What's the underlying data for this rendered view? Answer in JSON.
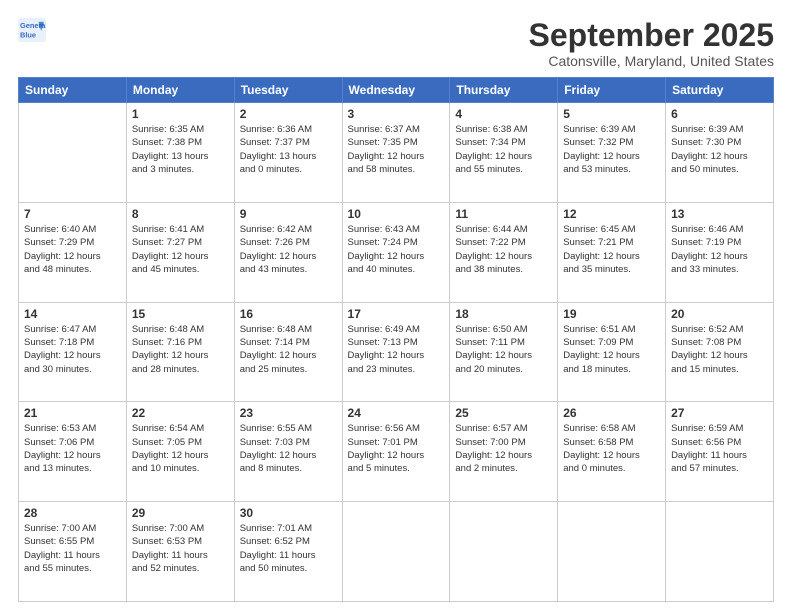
{
  "header": {
    "logo_line1": "General",
    "logo_line2": "Blue",
    "month_title": "September 2025",
    "location": "Catonsville, Maryland, United States"
  },
  "weekdays": [
    "Sunday",
    "Monday",
    "Tuesday",
    "Wednesday",
    "Thursday",
    "Friday",
    "Saturday"
  ],
  "weeks": [
    [
      {
        "day": "",
        "info": ""
      },
      {
        "day": "1",
        "info": "Sunrise: 6:35 AM\nSunset: 7:38 PM\nDaylight: 13 hours\nand 3 minutes."
      },
      {
        "day": "2",
        "info": "Sunrise: 6:36 AM\nSunset: 7:37 PM\nDaylight: 13 hours\nand 0 minutes."
      },
      {
        "day": "3",
        "info": "Sunrise: 6:37 AM\nSunset: 7:35 PM\nDaylight: 12 hours\nand 58 minutes."
      },
      {
        "day": "4",
        "info": "Sunrise: 6:38 AM\nSunset: 7:34 PM\nDaylight: 12 hours\nand 55 minutes."
      },
      {
        "day": "5",
        "info": "Sunrise: 6:39 AM\nSunset: 7:32 PM\nDaylight: 12 hours\nand 53 minutes."
      },
      {
        "day": "6",
        "info": "Sunrise: 6:39 AM\nSunset: 7:30 PM\nDaylight: 12 hours\nand 50 minutes."
      }
    ],
    [
      {
        "day": "7",
        "info": "Sunrise: 6:40 AM\nSunset: 7:29 PM\nDaylight: 12 hours\nand 48 minutes."
      },
      {
        "day": "8",
        "info": "Sunrise: 6:41 AM\nSunset: 7:27 PM\nDaylight: 12 hours\nand 45 minutes."
      },
      {
        "day": "9",
        "info": "Sunrise: 6:42 AM\nSunset: 7:26 PM\nDaylight: 12 hours\nand 43 minutes."
      },
      {
        "day": "10",
        "info": "Sunrise: 6:43 AM\nSunset: 7:24 PM\nDaylight: 12 hours\nand 40 minutes."
      },
      {
        "day": "11",
        "info": "Sunrise: 6:44 AM\nSunset: 7:22 PM\nDaylight: 12 hours\nand 38 minutes."
      },
      {
        "day": "12",
        "info": "Sunrise: 6:45 AM\nSunset: 7:21 PM\nDaylight: 12 hours\nand 35 minutes."
      },
      {
        "day": "13",
        "info": "Sunrise: 6:46 AM\nSunset: 7:19 PM\nDaylight: 12 hours\nand 33 minutes."
      }
    ],
    [
      {
        "day": "14",
        "info": "Sunrise: 6:47 AM\nSunset: 7:18 PM\nDaylight: 12 hours\nand 30 minutes."
      },
      {
        "day": "15",
        "info": "Sunrise: 6:48 AM\nSunset: 7:16 PM\nDaylight: 12 hours\nand 28 minutes."
      },
      {
        "day": "16",
        "info": "Sunrise: 6:48 AM\nSunset: 7:14 PM\nDaylight: 12 hours\nand 25 minutes."
      },
      {
        "day": "17",
        "info": "Sunrise: 6:49 AM\nSunset: 7:13 PM\nDaylight: 12 hours\nand 23 minutes."
      },
      {
        "day": "18",
        "info": "Sunrise: 6:50 AM\nSunset: 7:11 PM\nDaylight: 12 hours\nand 20 minutes."
      },
      {
        "day": "19",
        "info": "Sunrise: 6:51 AM\nSunset: 7:09 PM\nDaylight: 12 hours\nand 18 minutes."
      },
      {
        "day": "20",
        "info": "Sunrise: 6:52 AM\nSunset: 7:08 PM\nDaylight: 12 hours\nand 15 minutes."
      }
    ],
    [
      {
        "day": "21",
        "info": "Sunrise: 6:53 AM\nSunset: 7:06 PM\nDaylight: 12 hours\nand 13 minutes."
      },
      {
        "day": "22",
        "info": "Sunrise: 6:54 AM\nSunset: 7:05 PM\nDaylight: 12 hours\nand 10 minutes."
      },
      {
        "day": "23",
        "info": "Sunrise: 6:55 AM\nSunset: 7:03 PM\nDaylight: 12 hours\nand 8 minutes."
      },
      {
        "day": "24",
        "info": "Sunrise: 6:56 AM\nSunset: 7:01 PM\nDaylight: 12 hours\nand 5 minutes."
      },
      {
        "day": "25",
        "info": "Sunrise: 6:57 AM\nSunset: 7:00 PM\nDaylight: 12 hours\nand 2 minutes."
      },
      {
        "day": "26",
        "info": "Sunrise: 6:58 AM\nSunset: 6:58 PM\nDaylight: 12 hours\nand 0 minutes."
      },
      {
        "day": "27",
        "info": "Sunrise: 6:59 AM\nSunset: 6:56 PM\nDaylight: 11 hours\nand 57 minutes."
      }
    ],
    [
      {
        "day": "28",
        "info": "Sunrise: 7:00 AM\nSunset: 6:55 PM\nDaylight: 11 hours\nand 55 minutes."
      },
      {
        "day": "29",
        "info": "Sunrise: 7:00 AM\nSunset: 6:53 PM\nDaylight: 11 hours\nand 52 minutes."
      },
      {
        "day": "30",
        "info": "Sunrise: 7:01 AM\nSunset: 6:52 PM\nDaylight: 11 hours\nand 50 minutes."
      },
      {
        "day": "",
        "info": ""
      },
      {
        "day": "",
        "info": ""
      },
      {
        "day": "",
        "info": ""
      },
      {
        "day": "",
        "info": ""
      }
    ]
  ]
}
